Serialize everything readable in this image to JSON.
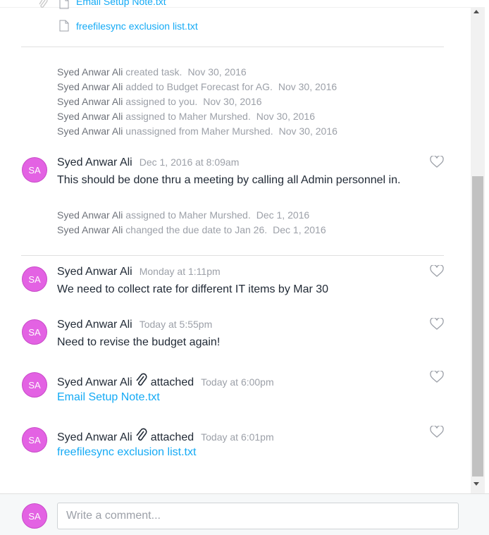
{
  "attachments_list": [
    {
      "name": "Email Setup Note.txt"
    },
    {
      "name": "freefilesync exclusion list.txt"
    }
  ],
  "stories_1": [
    {
      "actor": "Syed Anwar Ali",
      "action": "created task.",
      "date": "Nov 30, 2016"
    },
    {
      "actor": "Syed Anwar Ali",
      "action": "added to Budget Forecast for AG.",
      "date": "Nov 30, 2016"
    },
    {
      "actor": "Syed Anwar Ali",
      "action": "assigned to you.",
      "date": "Nov 30, 2016"
    },
    {
      "actor": "Syed Anwar Ali",
      "action": "assigned to Maher Murshed.",
      "date": "Nov 30, 2016"
    },
    {
      "actor": "Syed Anwar Ali",
      "action": "unassigned from Maher Murshed.",
      "date": "Nov 30, 2016"
    }
  ],
  "comments": [
    {
      "initials": "SA",
      "author": "Syed Anwar Ali",
      "time": "Dec 1, 2016 at 8:09am",
      "text": "This should be done thru a meeting by calling all Admin personnel in."
    },
    {
      "initials": "SA",
      "author": "Syed Anwar Ali",
      "time": "Monday at 1:11pm",
      "text": "We need to collect rate for different IT items by Mar 30"
    },
    {
      "initials": "SA",
      "author": "Syed Anwar Ali",
      "time": "Today at 5:55pm",
      "text": "Need to revise the budget again!"
    },
    {
      "initials": "SA",
      "author": "Syed Anwar Ali",
      "attached_label": "attached",
      "time": "Today at 6:00pm",
      "file": "Email Setup Note.txt"
    },
    {
      "initials": "SA",
      "author": "Syed Anwar Ali",
      "attached_label": "attached",
      "time": "Today at 6:01pm",
      "file": "freefilesync exclusion list.txt"
    }
  ],
  "stories_2": [
    {
      "actor": "Syed Anwar Ali",
      "action": "assigned to Maher Murshed.",
      "date": "Dec 1, 2016"
    },
    {
      "actor": "Syed Anwar Ali",
      "action": "changed the due date to Jan 26.",
      "date": "Dec 1, 2016"
    }
  ],
  "composer": {
    "initials": "SA",
    "placeholder": "Write a comment..."
  },
  "icons": {
    "heart": "heart-icon",
    "paperclip": "paperclip-icon",
    "file": "file-icon"
  },
  "colors": {
    "avatar": "#e362e3",
    "link": "#14aaf5",
    "muted": "#9ca0a8",
    "text": "#222b37"
  }
}
